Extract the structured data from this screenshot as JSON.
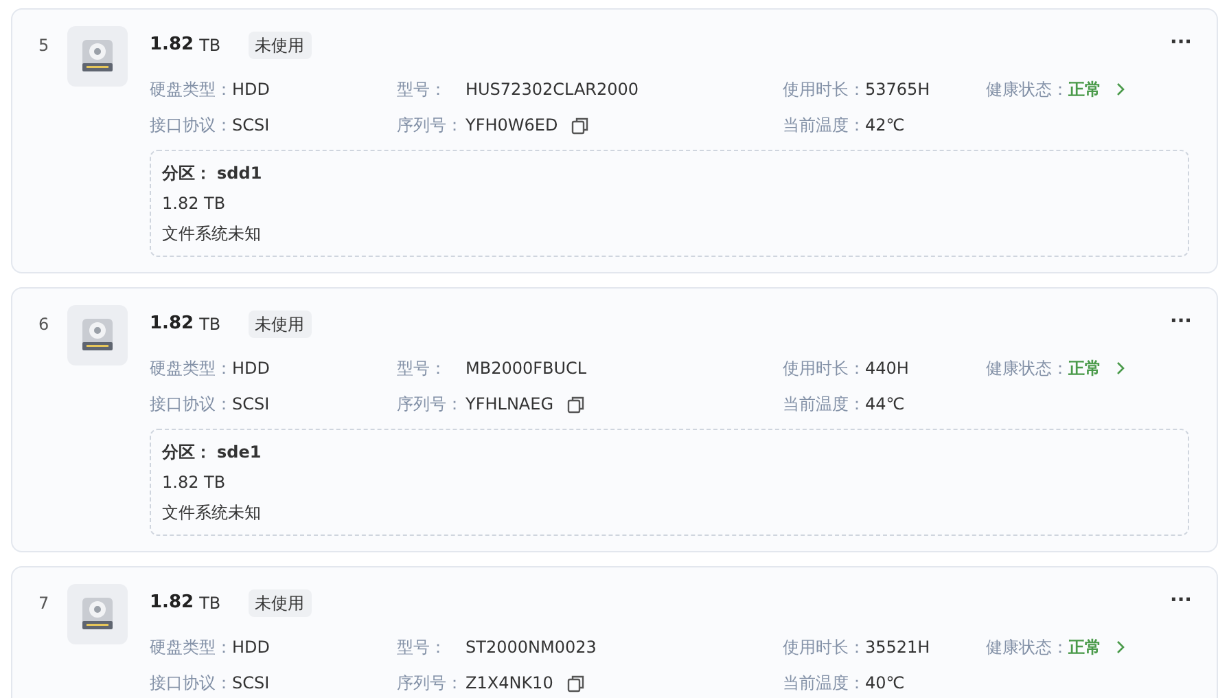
{
  "disks": [
    {
      "index": "5",
      "size": "1.82",
      "unit": "TB",
      "tag": "未使用",
      "menu": "···",
      "info": [
        {
          "kind": "text",
          "label": "硬盘类型：",
          "value": "HDD"
        },
        {
          "kind": "text",
          "label": "型号：",
          "value": "HUS72302CLAR2000"
        },
        {
          "kind": "text",
          "label": "使用时长：",
          "value": "53765H"
        },
        {
          "kind": "health",
          "label": "健康状态：",
          "value": "正常"
        },
        {
          "kind": "text",
          "label": "接口协议：",
          "value": "SCSI"
        },
        {
          "kind": "serial",
          "label": "序列号：",
          "value": "YFH0W6ED"
        },
        {
          "kind": "text",
          "label": "当前温度：",
          "value": "42℃"
        }
      ],
      "partition": {
        "label": "分区：",
        "name": "sdd1",
        "size": "1.82 TB",
        "filesystem": "文件系统未知"
      }
    },
    {
      "index": "6",
      "size": "1.82",
      "unit": "TB",
      "tag": "未使用",
      "menu": "···",
      "info": [
        {
          "kind": "text",
          "label": "硬盘类型：",
          "value": "HDD"
        },
        {
          "kind": "text",
          "label": "型号：",
          "value": "MB2000FBUCL"
        },
        {
          "kind": "text",
          "label": "使用时长：",
          "value": "440H"
        },
        {
          "kind": "health",
          "label": "健康状态：",
          "value": "正常"
        },
        {
          "kind": "text",
          "label": "接口协议：",
          "value": "SCSI"
        },
        {
          "kind": "serial",
          "label": "序列号：",
          "value": "YFHLNAEG"
        },
        {
          "kind": "text",
          "label": "当前温度：",
          "value": "44℃"
        }
      ],
      "partition": {
        "label": "分区：",
        "name": "sde1",
        "size": "1.82 TB",
        "filesystem": "文件系统未知"
      }
    },
    {
      "index": "7",
      "size": "1.82",
      "unit": "TB",
      "tag": "未使用",
      "menu": "···",
      "info": [
        {
          "kind": "text",
          "label": "硬盘类型：",
          "value": "HDD"
        },
        {
          "kind": "text",
          "label": "型号：",
          "value": "ST2000NM0023"
        },
        {
          "kind": "text",
          "label": "使用时长：",
          "value": "35521H"
        },
        {
          "kind": "health",
          "label": "健康状态：",
          "value": "正常"
        },
        {
          "kind": "text",
          "label": "接口协议：",
          "value": "SCSI"
        },
        {
          "kind": "serial",
          "label": "序列号：",
          "value": "Z1X4NK10"
        },
        {
          "kind": "text",
          "label": "当前温度：",
          "value": "40℃"
        }
      ]
    }
  ]
}
